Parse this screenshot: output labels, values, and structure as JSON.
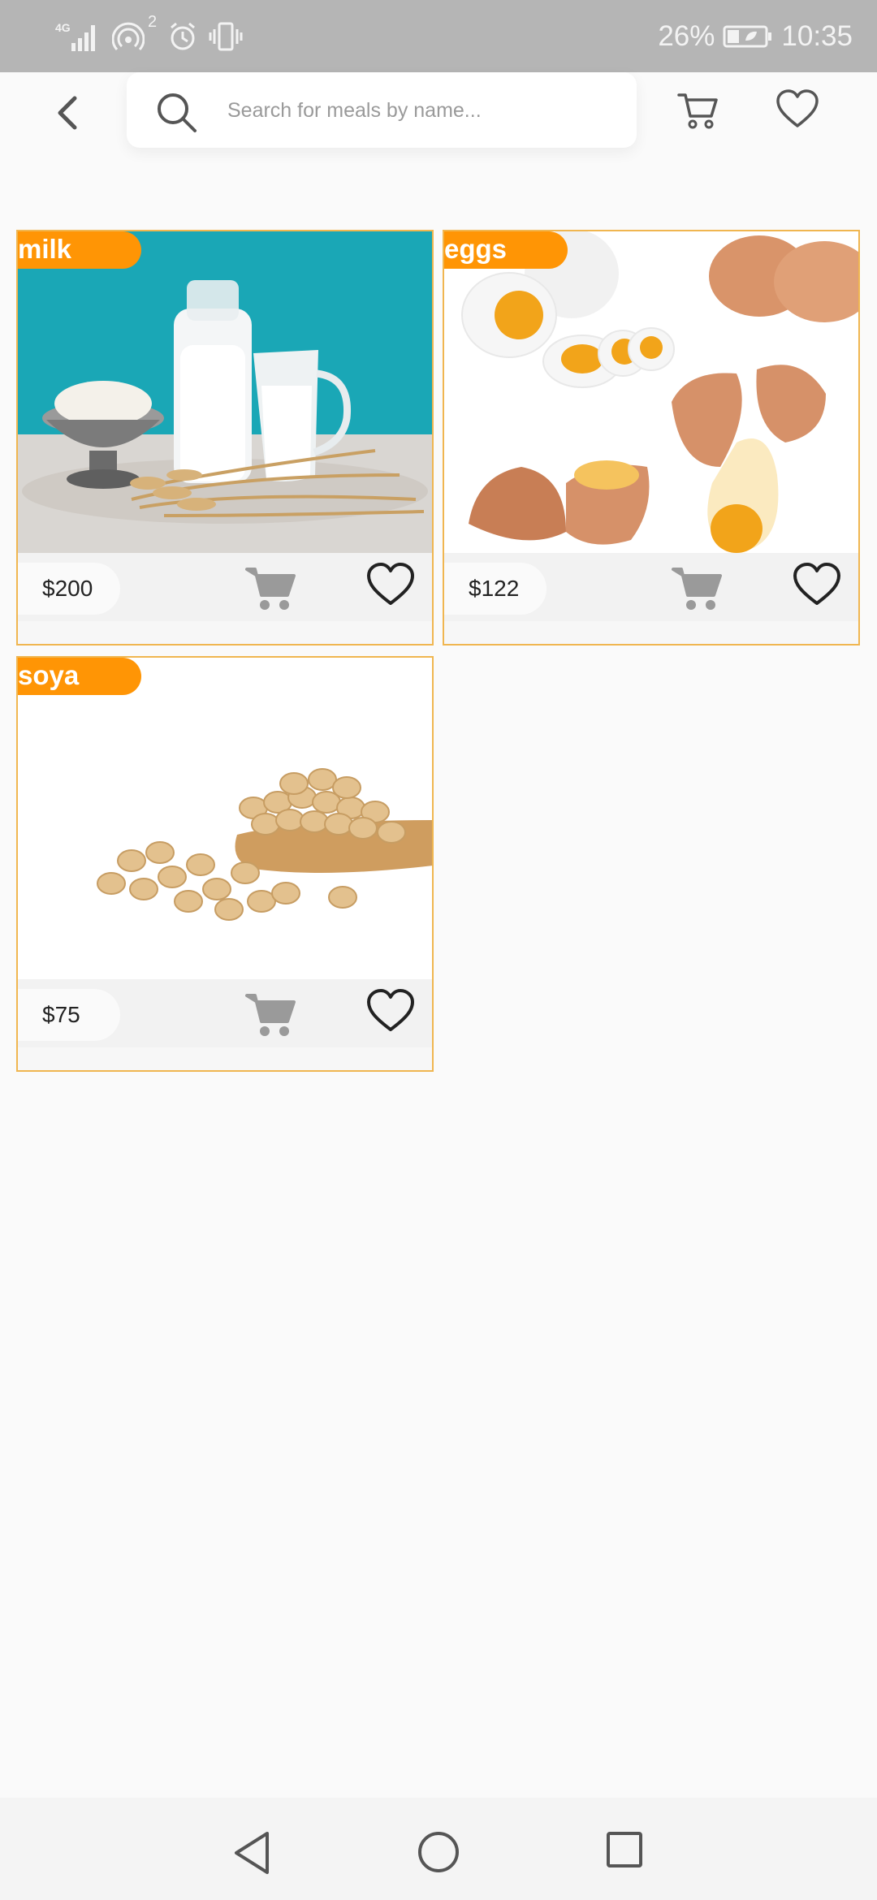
{
  "status_bar": {
    "network": "4G",
    "notification_count": "2",
    "battery": "26%",
    "time": "10:35"
  },
  "search": {
    "placeholder": "Search for meals by name..."
  },
  "products": [
    {
      "name": "milk",
      "price": "$200"
    },
    {
      "name": "eggs",
      "price": "$122"
    },
    {
      "name": "soya",
      "price": "$75"
    }
  ],
  "colors": {
    "accent": "#ff9505",
    "card_border": "#f0b650",
    "milk_bg": "#1aa7b6"
  },
  "icons": [
    "back-icon",
    "search-icon",
    "cart-icon",
    "heart-icon",
    "nav-back-icon",
    "nav-home-icon",
    "nav-recent-icon"
  ]
}
